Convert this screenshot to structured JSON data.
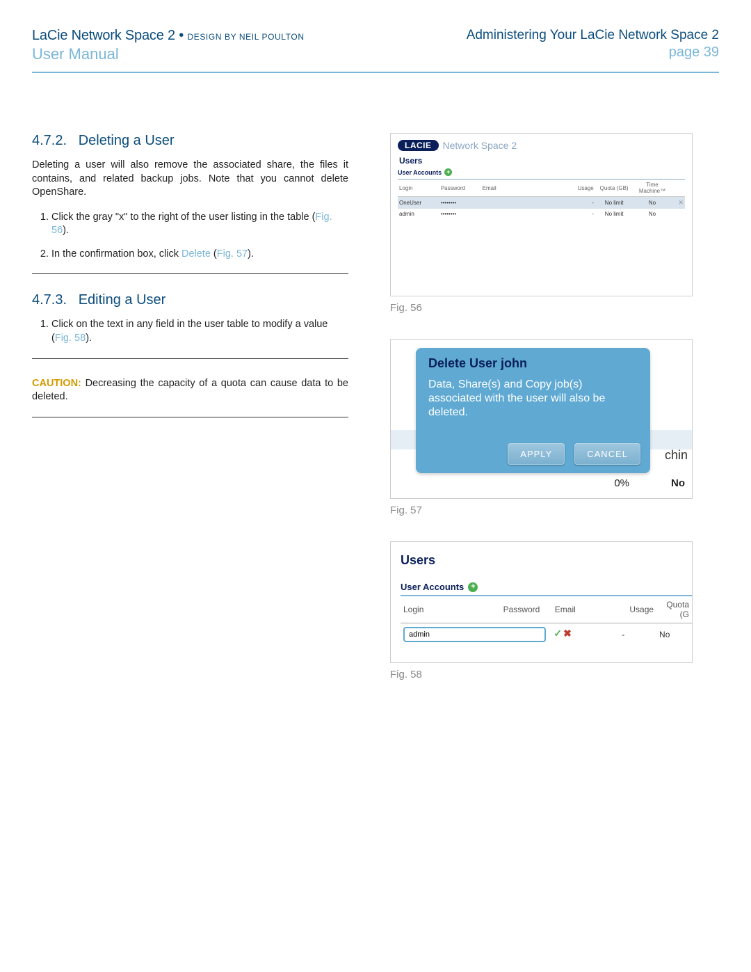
{
  "header": {
    "product": "LaCie Network Space 2",
    "bullet": " • ",
    "design": "DESIGN BY NEIL POULTON",
    "manual": "User Manual",
    "chapter": "Administering Your LaCie Network Space 2",
    "page": "page 39"
  },
  "left": {
    "s472": {
      "heading_num": "4.7.2.",
      "heading": "Deleting a User",
      "para": "Deleting a user will also remove the associated share, the files it contains, and related backup jobs. Note that you cannot delete OpenShare.",
      "step1_a": "Click the gray \"x\" to the right of the user listing in the table (",
      "step1_fig": "Fig. 56",
      "step1_b": ").",
      "step2_a": "In the confirmation box, click ",
      "step2_btn": "Delete",
      "step2_b": " (",
      "step2_fig": "Fig. 57",
      "step2_c": ")."
    },
    "s473": {
      "heading_num": "4.7.3.",
      "heading": "Editing a User",
      "step1_a": "Click on the text in any field in the user table to modify a value (",
      "step1_fig": "Fig. 58",
      "step1_b": ")."
    },
    "caution": {
      "label": "CAUTION:",
      "text": " Decreasing the capacity of a quota can cause data to be deleted."
    }
  },
  "right": {
    "fig56": {
      "caption": "Fig. 56",
      "brand": "LACIE",
      "title": "Network Space 2",
      "users": "Users",
      "ua": "User Accounts",
      "cols": {
        "login": "Login",
        "pw": "Password",
        "email": "Email",
        "usage": "Usage",
        "quota": "Quota (GB)",
        "tm": "Time Machine™"
      },
      "rows": [
        {
          "login": "OneUser",
          "pw": "••••••••",
          "email": "",
          "usage": "-",
          "quota": "No limit",
          "tm": "No",
          "del": true
        },
        {
          "login": "admin",
          "pw": "••••••••",
          "email": "",
          "usage": "-",
          "quota": "No limit",
          "tm": "No",
          "del": false
        }
      ]
    },
    "fig57": {
      "caption": "Fig. 57",
      "title": "Delete User john",
      "text": "Data, Share(s) and Copy job(s) associated with the user will also be deleted.",
      "apply": "APPLY",
      "cancel": "CANCEL",
      "chin": "chin",
      "v1": "0%",
      "v2": "No"
    },
    "fig58": {
      "caption": "Fig. 58",
      "users": "Users",
      "ua": "User Accounts",
      "cols": {
        "login": "Login",
        "pw": "Password",
        "email": "Email",
        "usage": "Usage",
        "quota": "Quota (G"
      },
      "row": {
        "edit_value": "admin",
        "usage": "-",
        "quota": "No"
      }
    }
  }
}
